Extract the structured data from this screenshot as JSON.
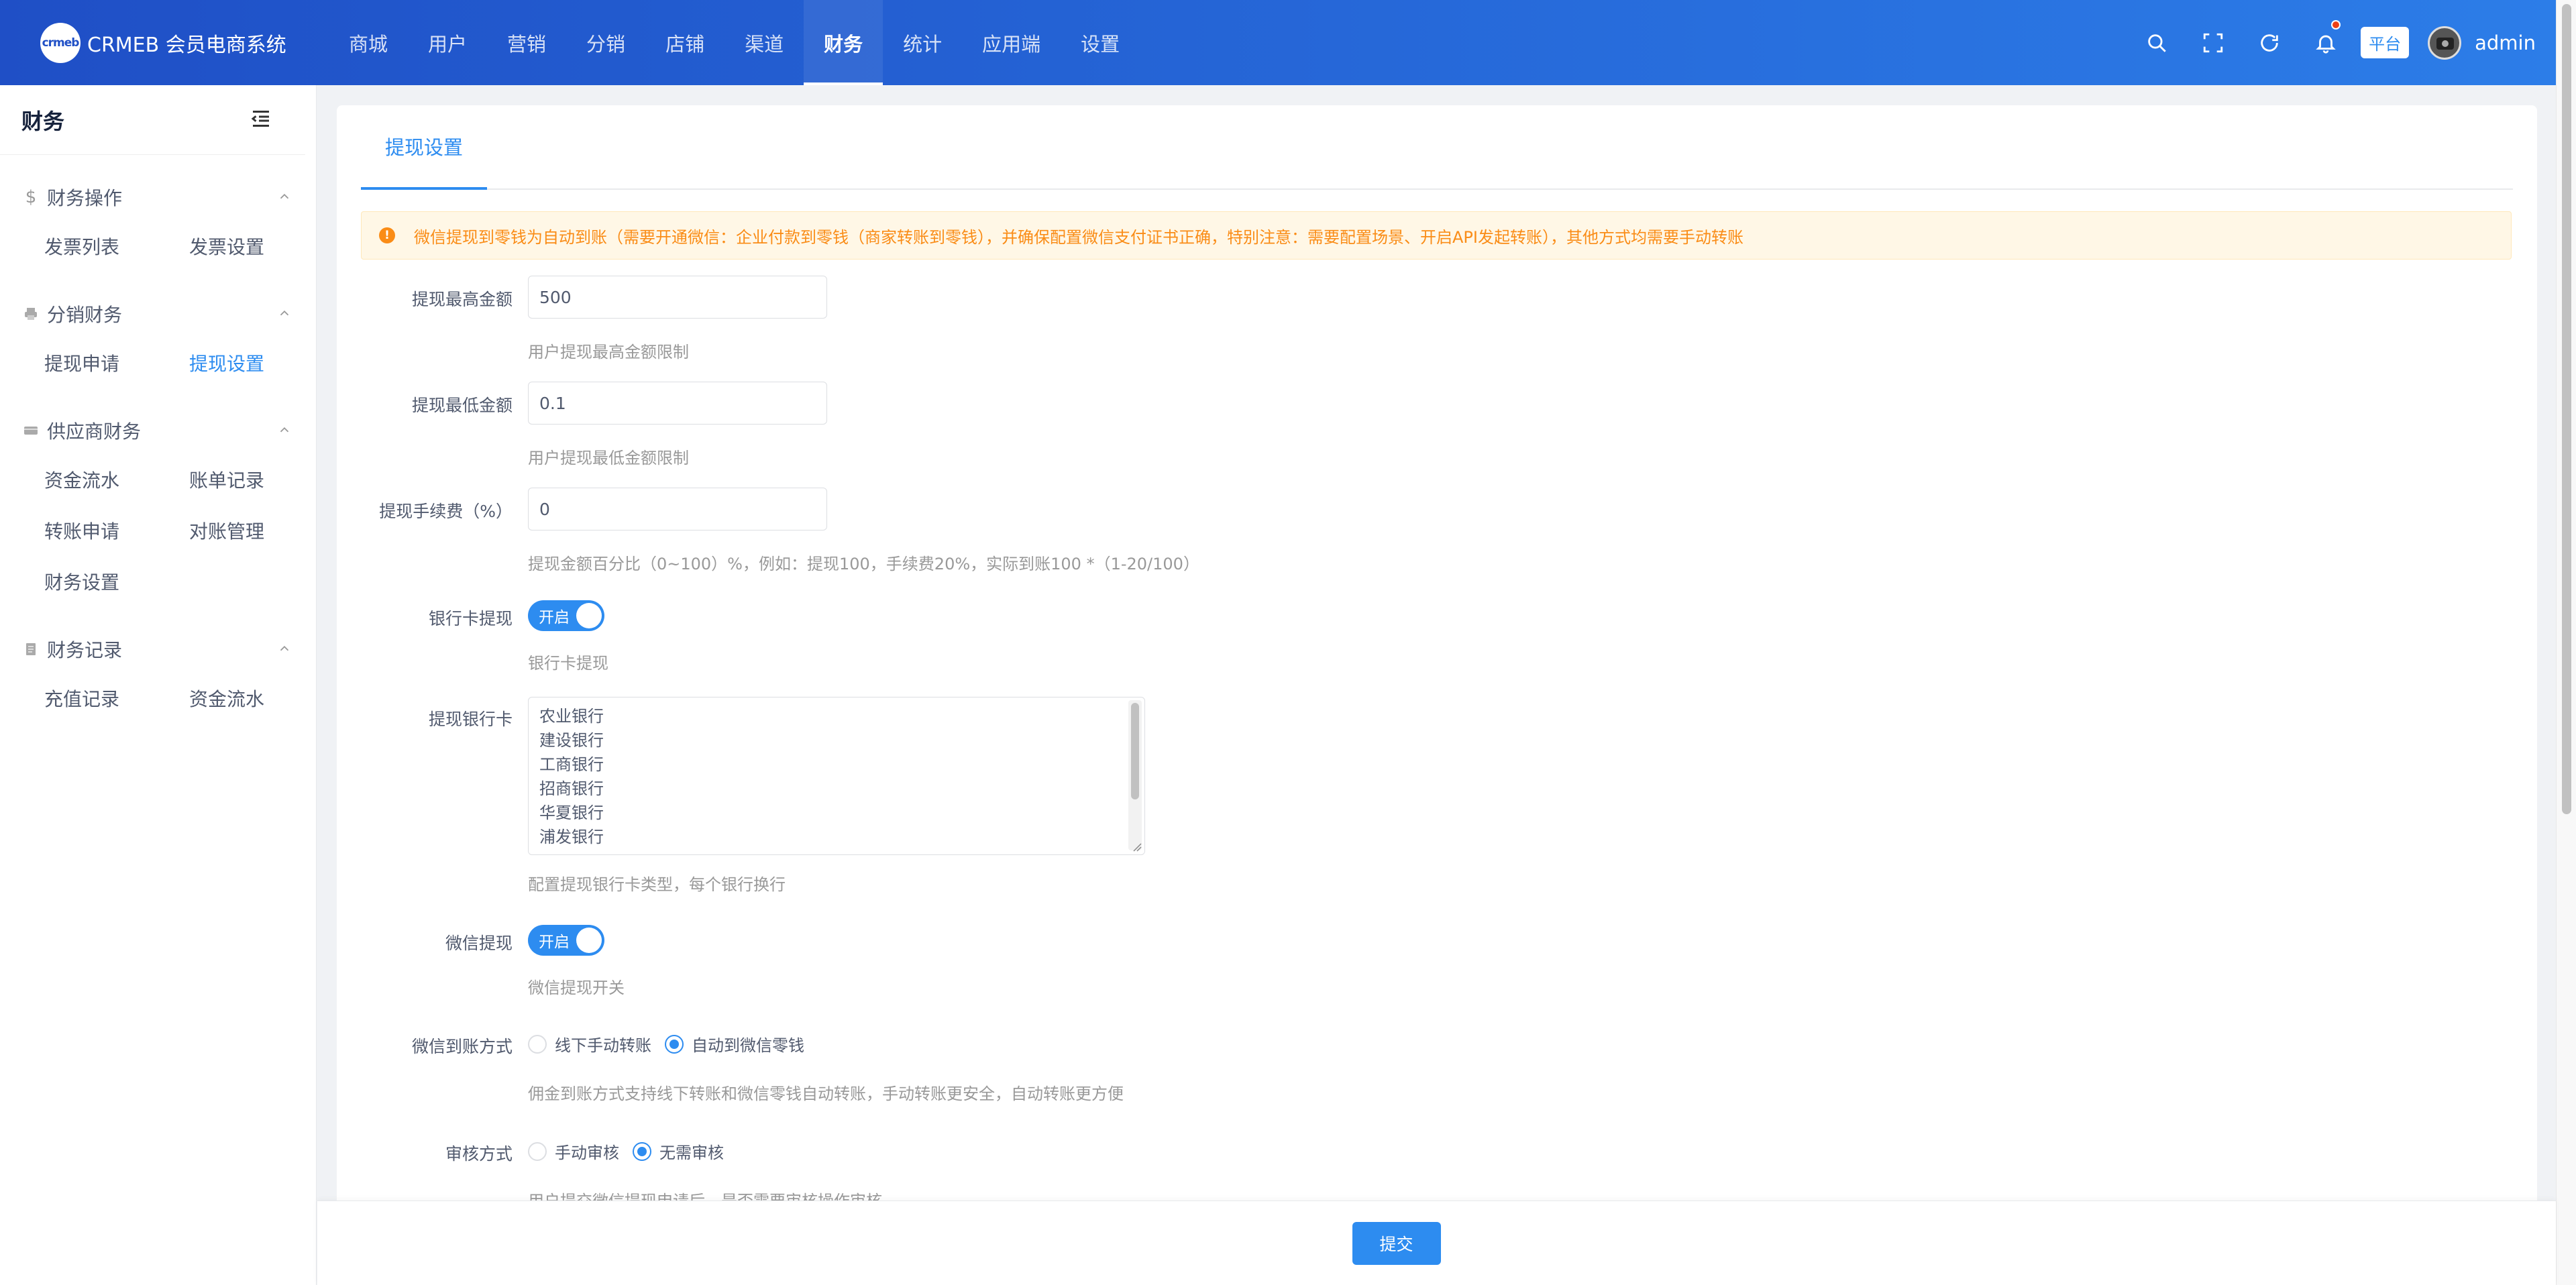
{
  "brand": {
    "badge_text": "crmeb",
    "name": "CRMEB 会员电商系统"
  },
  "top_nav": [
    {
      "label": "商城",
      "active": false
    },
    {
      "label": "用户",
      "active": false
    },
    {
      "label": "营销",
      "active": false
    },
    {
      "label": "分销",
      "active": false
    },
    {
      "label": "店铺",
      "active": false
    },
    {
      "label": "渠道",
      "active": false
    },
    {
      "label": "财务",
      "active": true
    },
    {
      "label": "统计",
      "active": false
    },
    {
      "label": "应用端",
      "active": false
    },
    {
      "label": "设置",
      "active": false
    }
  ],
  "header_right": {
    "icons": [
      "search-icon",
      "fullscreen-icon",
      "refresh-icon",
      "bell-icon"
    ],
    "platform_tag": "平台",
    "username": "admin"
  },
  "sidebar": {
    "title": "财务",
    "groups": [
      {
        "label": "财务操作",
        "icon": "dollar-icon",
        "items": [
          "发票列表",
          "发票设置"
        ]
      },
      {
        "label": "分销财务",
        "icon": "printer-icon",
        "items": [
          "提现申请",
          "提现设置"
        ]
      },
      {
        "label": "供应商财务",
        "icon": "card-icon",
        "items": [
          "资金流水",
          "账单记录",
          "转账申请",
          "对账管理",
          "财务设置"
        ]
      },
      {
        "label": "财务记录",
        "icon": "document-icon",
        "items": [
          "充值记录",
          "资金流水"
        ]
      }
    ],
    "active_item": "提现设置"
  },
  "main": {
    "tab_label": "提现设置",
    "alert": "微信提现到零钱为自动到账（需要开通微信：企业付款到零钱（商家转账到零钱），并确保配置微信支付证书正确，特别注意：需要配置场景、开启API发起转账），其他方式均需要手动转账",
    "form": {
      "max_amount": {
        "label": "提现最高金额",
        "value": "500",
        "help": "用户提现最高金额限制"
      },
      "min_amount": {
        "label": "提现最低金额",
        "value": "0.1",
        "help": "用户提现最低金额限制"
      },
      "fee": {
        "label": "提现手续费（%）",
        "value": "0",
        "help": "提现金额百分比（0~100）%，例如：提现100，手续费20%，实际到账100 *（1-20/100）"
      },
      "bank_withdraw": {
        "label": "银行卡提现",
        "switch_text": "开启",
        "help": "银行卡提现"
      },
      "banks": {
        "label": "提现银行卡",
        "lines": [
          "农业银行",
          "建设银行",
          "工商银行",
          "招商银行",
          "华夏银行",
          "浦发银行"
        ],
        "help": "配置提现银行卡类型，每个银行换行"
      },
      "wechat_withdraw": {
        "label": "微信提现",
        "switch_text": "开启",
        "help": "微信提现开关"
      },
      "wechat_method": {
        "label": "微信到账方式",
        "options": [
          "线下手动转账",
          "自动到微信零钱"
        ],
        "selected": 1,
        "help": "佣金到账方式支持线下转账和微信零钱自动转账，手动转账更安全，自动转账更方便"
      },
      "review": {
        "label": "审核方式",
        "options": [
          "手动审核",
          "无需审核"
        ],
        "selected": 1,
        "help": "用户提交微信提现申请后，是否需要审核操作审核"
      }
    },
    "submit_label": "提交"
  },
  "colors": {
    "primary": "#2d8cf0",
    "header_start": "#1f4fc6",
    "header_end": "#2c7de8",
    "warning": "#fa8c16"
  }
}
